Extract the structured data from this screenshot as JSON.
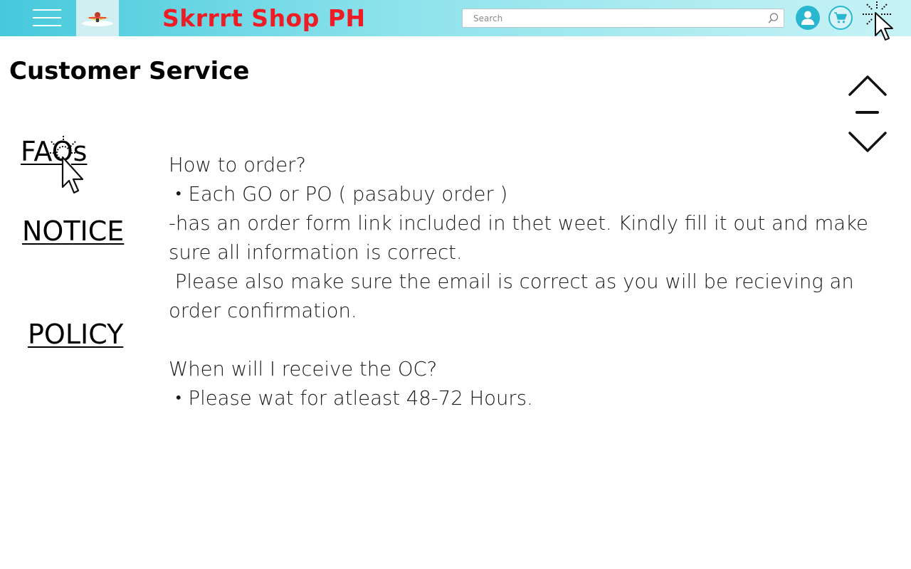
{
  "header": {
    "brand": "Skrrrt Shop PH",
    "search": {
      "placeholder": "Search"
    },
    "icons": [
      "menu-icon",
      "search-icon",
      "user-icon",
      "cart-icon"
    ],
    "colors": {
      "header_start": "#46c9dc",
      "brand": "#ee1c24",
      "icon_accent": "#29b6cf"
    }
  },
  "page": {
    "title": "Customer Service"
  },
  "sidebar": {
    "links": [
      {
        "label": "FAQs"
      },
      {
        "label": "NOTICE"
      },
      {
        "label": "POLICY"
      }
    ]
  },
  "content": {
    "lines": [
      "How to order?",
      "・Each GO or PO ( pasabuy order )",
      "-has an order form link included in thet weet. Kindly fill it out and make sure all information is correct.",
      " Please also make sure the email is correct as you will be recieving an order confirmation.",
      "When will I receive the OC?",
      "・Please wat for atleast 48-72 Hours."
    ]
  }
}
